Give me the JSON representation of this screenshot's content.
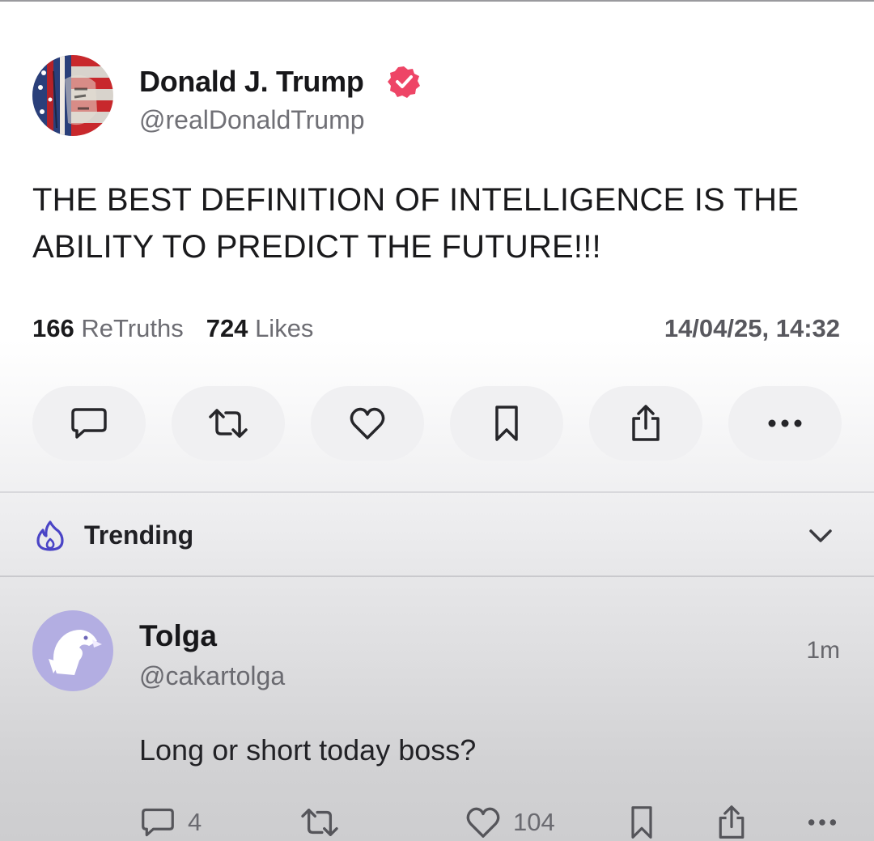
{
  "post": {
    "author": {
      "name": "Donald J. Trump",
      "handle": "@realDonaldTrump",
      "verified": true,
      "avatar_icon": "flag-portrait-avatar"
    },
    "text": "THE BEST DEFINITION OF INTELLIGENCE IS THE ABILITY TO PREDICT THE FUTURE!!!",
    "stats": {
      "retruths_count": "166",
      "retruths_label": "ReTruths",
      "likes_count": "724",
      "likes_label": "Likes"
    },
    "timestamp": "14/04/25, 14:32",
    "actions": [
      {
        "icon": "reply-icon"
      },
      {
        "icon": "retruth-icon"
      },
      {
        "icon": "heart-icon"
      },
      {
        "icon": "bookmark-icon"
      },
      {
        "icon": "share-icon"
      },
      {
        "icon": "more-icon"
      }
    ]
  },
  "trending": {
    "label": "Trending",
    "icon": "flame-icon",
    "icon_color": "#4a44c6",
    "expand_icon": "chevron-down-icon"
  },
  "reply": {
    "author": {
      "name": "Tolga",
      "handle": "@cakartolga",
      "avatar_icon": "eagle-avatar"
    },
    "time": "1m",
    "text": "Long or short today boss?",
    "actions": {
      "reply_count": "4",
      "like_count": "104"
    }
  },
  "colors": {
    "verified_badge": "#ee4566",
    "button_bg": "#f0f0f2",
    "avatar_purple": "#b3aee2"
  }
}
